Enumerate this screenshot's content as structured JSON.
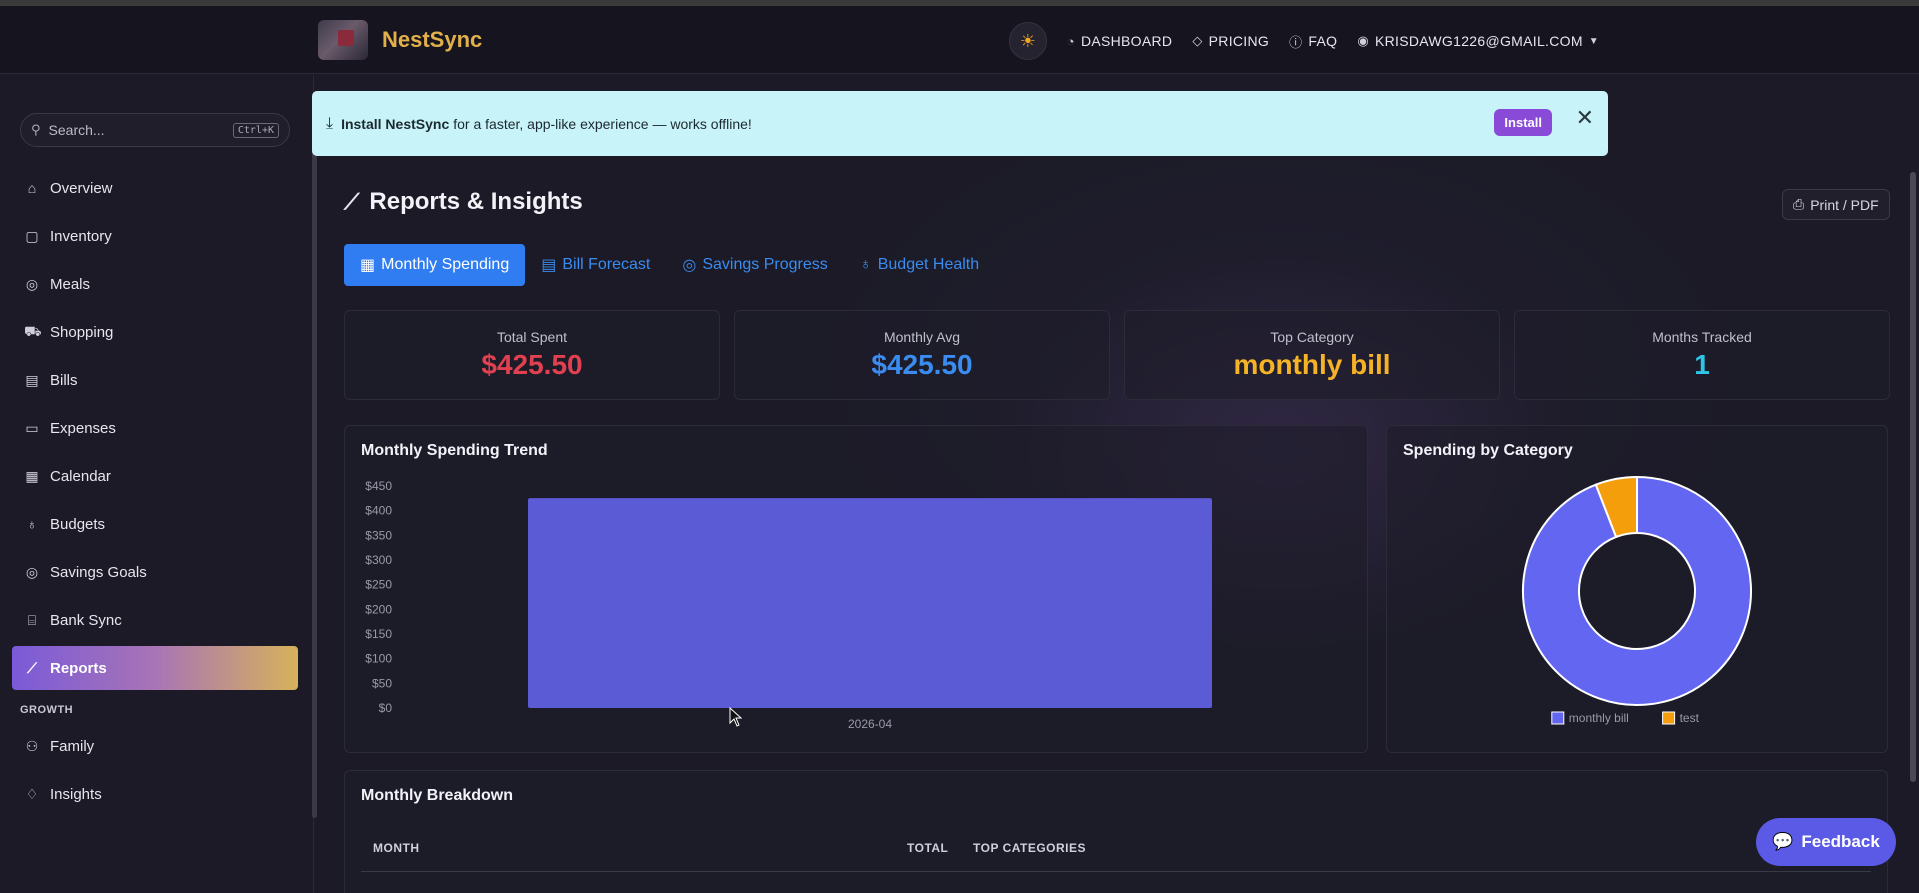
{
  "navbar": {
    "brand": "NestSync",
    "theme_icon": "sun-icon",
    "links": [
      {
        "icon": "gauge-icon",
        "label": "DASHBOARD"
      },
      {
        "icon": "diamond-icon",
        "label": "PRICING"
      },
      {
        "icon": "question-circle-icon",
        "label": "FAQ"
      }
    ],
    "user": "KRISDAWG1226@GMAIL.COM"
  },
  "sidebar": {
    "search_placeholder": "Search...",
    "search_shortcut": "Ctrl+K",
    "items": [
      {
        "icon": "house-icon",
        "label": "Overview"
      },
      {
        "icon": "box-icon",
        "label": "Inventory"
      },
      {
        "icon": "fork-icon",
        "label": "Meals"
      },
      {
        "icon": "cart-icon",
        "label": "Shopping"
      },
      {
        "icon": "receipt-icon",
        "label": "Bills"
      },
      {
        "icon": "wallet-icon",
        "label": "Expenses"
      },
      {
        "icon": "calendar-icon",
        "label": "Calendar"
      },
      {
        "icon": "piggy-bank-icon",
        "label": "Budgets"
      },
      {
        "icon": "target-icon",
        "label": "Savings Goals"
      },
      {
        "icon": "bank-icon",
        "label": "Bank Sync"
      },
      {
        "icon": "chart-line-icon",
        "label": "Reports"
      }
    ],
    "active_index": 10,
    "growth_label": "GROWTH",
    "growth_items": [
      {
        "icon": "people-icon",
        "label": "Family"
      },
      {
        "icon": "lightbulb-icon",
        "label": "Insights"
      }
    ]
  },
  "banner": {
    "bold": "Install NestSync",
    "text": "for a faster, app-like experience — works offline!",
    "install_label": "Install"
  },
  "page": {
    "title": "Reports & Insights",
    "print_label": "Print / PDF",
    "tabs": [
      {
        "icon": "calendar-icon",
        "label": "Monthly Spending"
      },
      {
        "icon": "receipt-icon",
        "label": "Bill Forecast"
      },
      {
        "icon": "target-icon",
        "label": "Savings Progress"
      },
      {
        "icon": "piggy-bank-icon",
        "label": "Budget Health"
      }
    ],
    "active_tab": 0
  },
  "stats": [
    {
      "label": "Total Spent",
      "value": "$425.50",
      "color": "#e0404f"
    },
    {
      "label": "Monthly Avg",
      "value": "$425.50",
      "color": "#3a8cf0"
    },
    {
      "label": "Top Category",
      "value": "monthly bill",
      "color": "#f5b325"
    },
    {
      "label": "Months Tracked",
      "value": "1",
      "color": "#2cc6e8"
    }
  ],
  "trend": {
    "title": "Monthly Spending Trend"
  },
  "category": {
    "title": "Spending by Category"
  },
  "breakdown": {
    "title": "Monthly Breakdown",
    "headers": [
      "MONTH",
      "TOTAL",
      "TOP CATEGORIES"
    ]
  },
  "feedback_label": "Feedback",
  "chart_data": [
    {
      "type": "bar",
      "title": "Monthly Spending Trend",
      "categories": [
        "2026-04"
      ],
      "values": [
        425.5
      ],
      "ylim": [
        0,
        450
      ],
      "yticks": [
        "$0",
        "$50",
        "$100",
        "$150",
        "$200",
        "$250",
        "$300",
        "$350",
        "$400",
        "$450"
      ],
      "color": "#5b5bd6",
      "grid": false,
      "legend": "none"
    },
    {
      "type": "pie",
      "title": "Spending by Category",
      "labels": [
        "monthly bill",
        "test"
      ],
      "values": [
        400.5,
        25
      ],
      "colors": [
        "#6366f1",
        "#f59e0b"
      ],
      "donut": true,
      "legend": "bottom"
    }
  ]
}
